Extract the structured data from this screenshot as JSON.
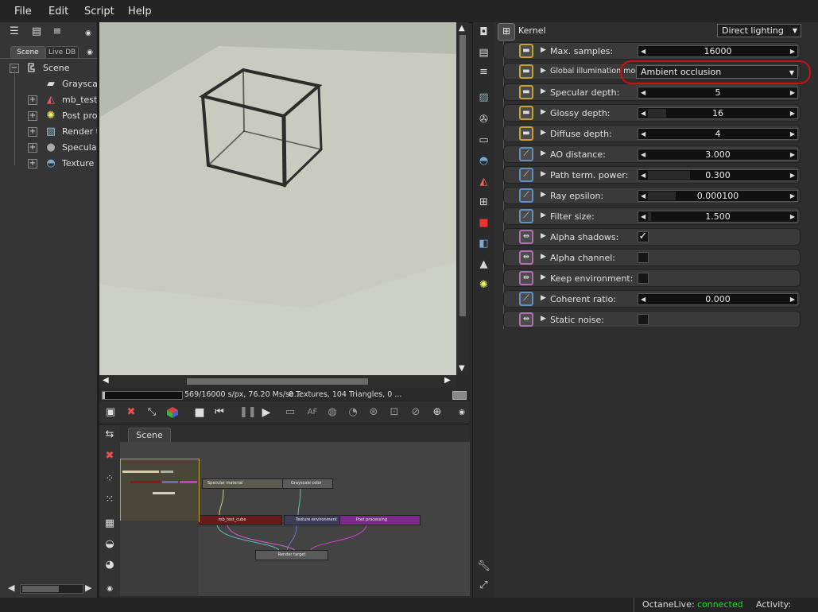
{
  "menu": [
    "File",
    "Edit",
    "Script",
    "Help"
  ],
  "left_panel": {
    "tabs": [
      "Scene",
      "Live DB"
    ],
    "tree_root": "Scene",
    "tree_items": [
      {
        "label": "Grayscale color",
        "expandable": false,
        "icon": "grayscale-icon"
      },
      {
        "label": "mb_test_cube",
        "expandable": true,
        "icon": "mesh-icon"
      },
      {
        "label": "Post processing",
        "expandable": true,
        "icon": "postproc-icon"
      },
      {
        "label": "Render target",
        "expandable": true,
        "icon": "render-target-icon"
      },
      {
        "label": "Specular material",
        "expandable": true,
        "icon": "specular-material-icon"
      },
      {
        "label": "Texture environment",
        "expandable": true,
        "icon": "texture-env-icon"
      }
    ]
  },
  "viewport_status": {
    "samples": "569/16000 s/px, 76.20 Ms/se...",
    "scene_stats": "0 Textures, 104 Triangles, 0 ..."
  },
  "node_graph": {
    "tab": "Scene",
    "nodes": [
      "Specular material",
      "Grayscale color",
      "mb_test_cube",
      "Texture environment",
      "Post processing",
      "Render target"
    ]
  },
  "inspector": {
    "node_name": "Kernel",
    "kernel_type": "Direct lighting",
    "params": [
      {
        "label": "Max. samples:",
        "kind": "slider",
        "value": "16000",
        "fill": 0,
        "icon": "int-icon"
      },
      {
        "label": "Global illumination mode:",
        "kind": "dropdown",
        "value": "Ambient occlusion",
        "icon": "enum-icon"
      },
      {
        "label": "Specular depth:",
        "kind": "slider",
        "value": "5",
        "fill": 0,
        "icon": "int-icon"
      },
      {
        "label": "Glossy depth:",
        "kind": "slider",
        "value": "16",
        "fill": 0.13,
        "icon": "int-icon"
      },
      {
        "label": "Diffuse depth:",
        "kind": "slider",
        "value": "4",
        "fill": 0,
        "icon": "int-icon"
      },
      {
        "label": "AO distance:",
        "kind": "slider",
        "value": "3.000",
        "fill": 0,
        "icon": "float-icon"
      },
      {
        "label": "Path term. power:",
        "kind": "slider",
        "value": "0.300",
        "fill": 0.3,
        "icon": "float-icon"
      },
      {
        "label": "Ray epsilon:",
        "kind": "slider",
        "value": "0.000100",
        "fill": 0.2,
        "icon": "float-icon"
      },
      {
        "label": "Filter size:",
        "kind": "slider",
        "value": "1.500",
        "fill": 0.02,
        "icon": "float-icon"
      },
      {
        "label": "Alpha shadows:",
        "kind": "checkbox",
        "checked": true,
        "icon": "bool-icon"
      },
      {
        "label": "Alpha channel:",
        "kind": "checkbox",
        "checked": false,
        "icon": "bool-icon"
      },
      {
        "label": "Keep environment:",
        "kind": "checkbox",
        "checked": false,
        "icon": "bool-icon"
      },
      {
        "label": "Coherent ratio:",
        "kind": "slider",
        "value": "0.000",
        "fill": 0,
        "icon": "float-icon"
      },
      {
        "label": "Static noise:",
        "kind": "checkbox",
        "checked": false,
        "icon": "bool-icon"
      }
    ]
  },
  "status": {
    "live_label": "OctaneLive:",
    "live_value": "connected",
    "activity_label": "Activity:"
  },
  "colors": {
    "highlight_circle": "#d01010",
    "connected": "#27d827",
    "viewport_bg": "#b9bcb1"
  }
}
